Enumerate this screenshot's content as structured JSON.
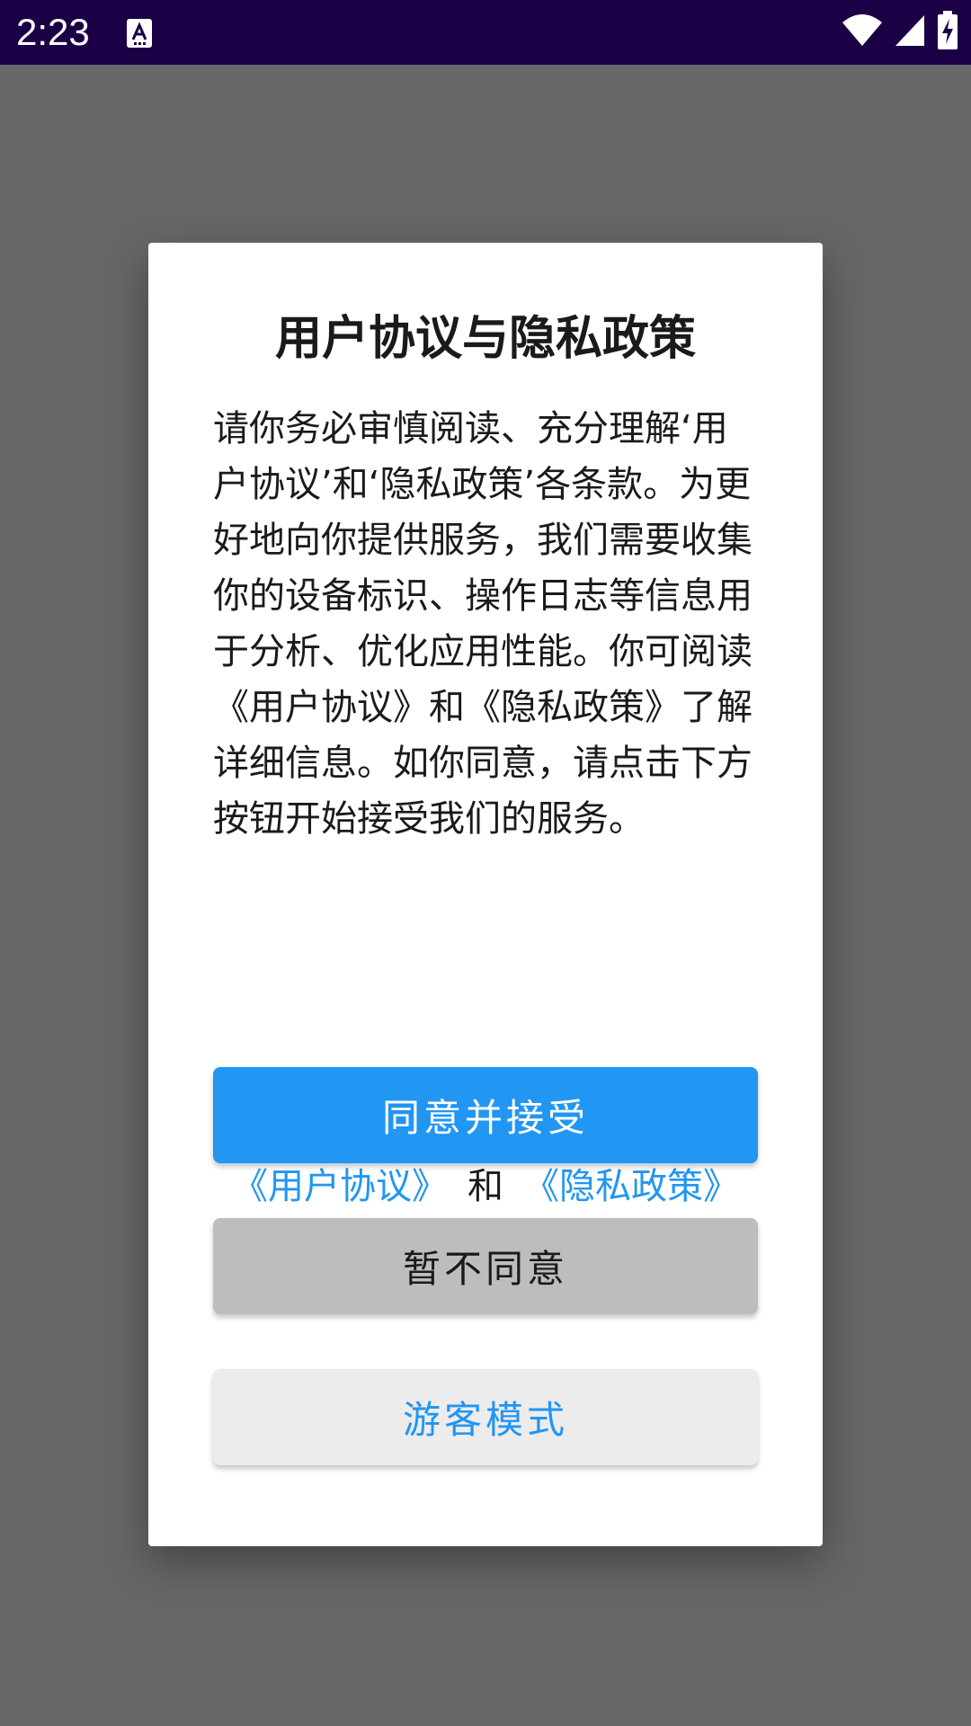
{
  "status_bar": {
    "time": "2:23",
    "app_icon": "a-icon",
    "icons": [
      "wifi-icon",
      "signal-icon",
      "battery-charging-icon"
    ]
  },
  "dialog": {
    "title": "用户协议与隐私政策",
    "body": "请你务必审慎阅读、充分理解‘用户协议’和‘隐私政策’各条款。为更好地向你提供服务，我们需要收集你的设备标识、操作日志等信息用于分析、优化应用性能。你可阅读《用户协议》和《隐私政策》了解详细信息。如你同意，请点击下方按钮开始接受我们的服务。",
    "links": {
      "user_agreement": "《用户协议》",
      "and": "和",
      "privacy_policy": "《隐私政策》"
    },
    "buttons": {
      "accept": "同意并接受",
      "decline": "暂不同意",
      "guest": "游客模式"
    }
  },
  "colors": {
    "status_bar": "#1c0046",
    "overlay": "#676767",
    "accent": "#2196f3",
    "decline_button": "#bdbdbd",
    "guest_button": "#ececec"
  }
}
